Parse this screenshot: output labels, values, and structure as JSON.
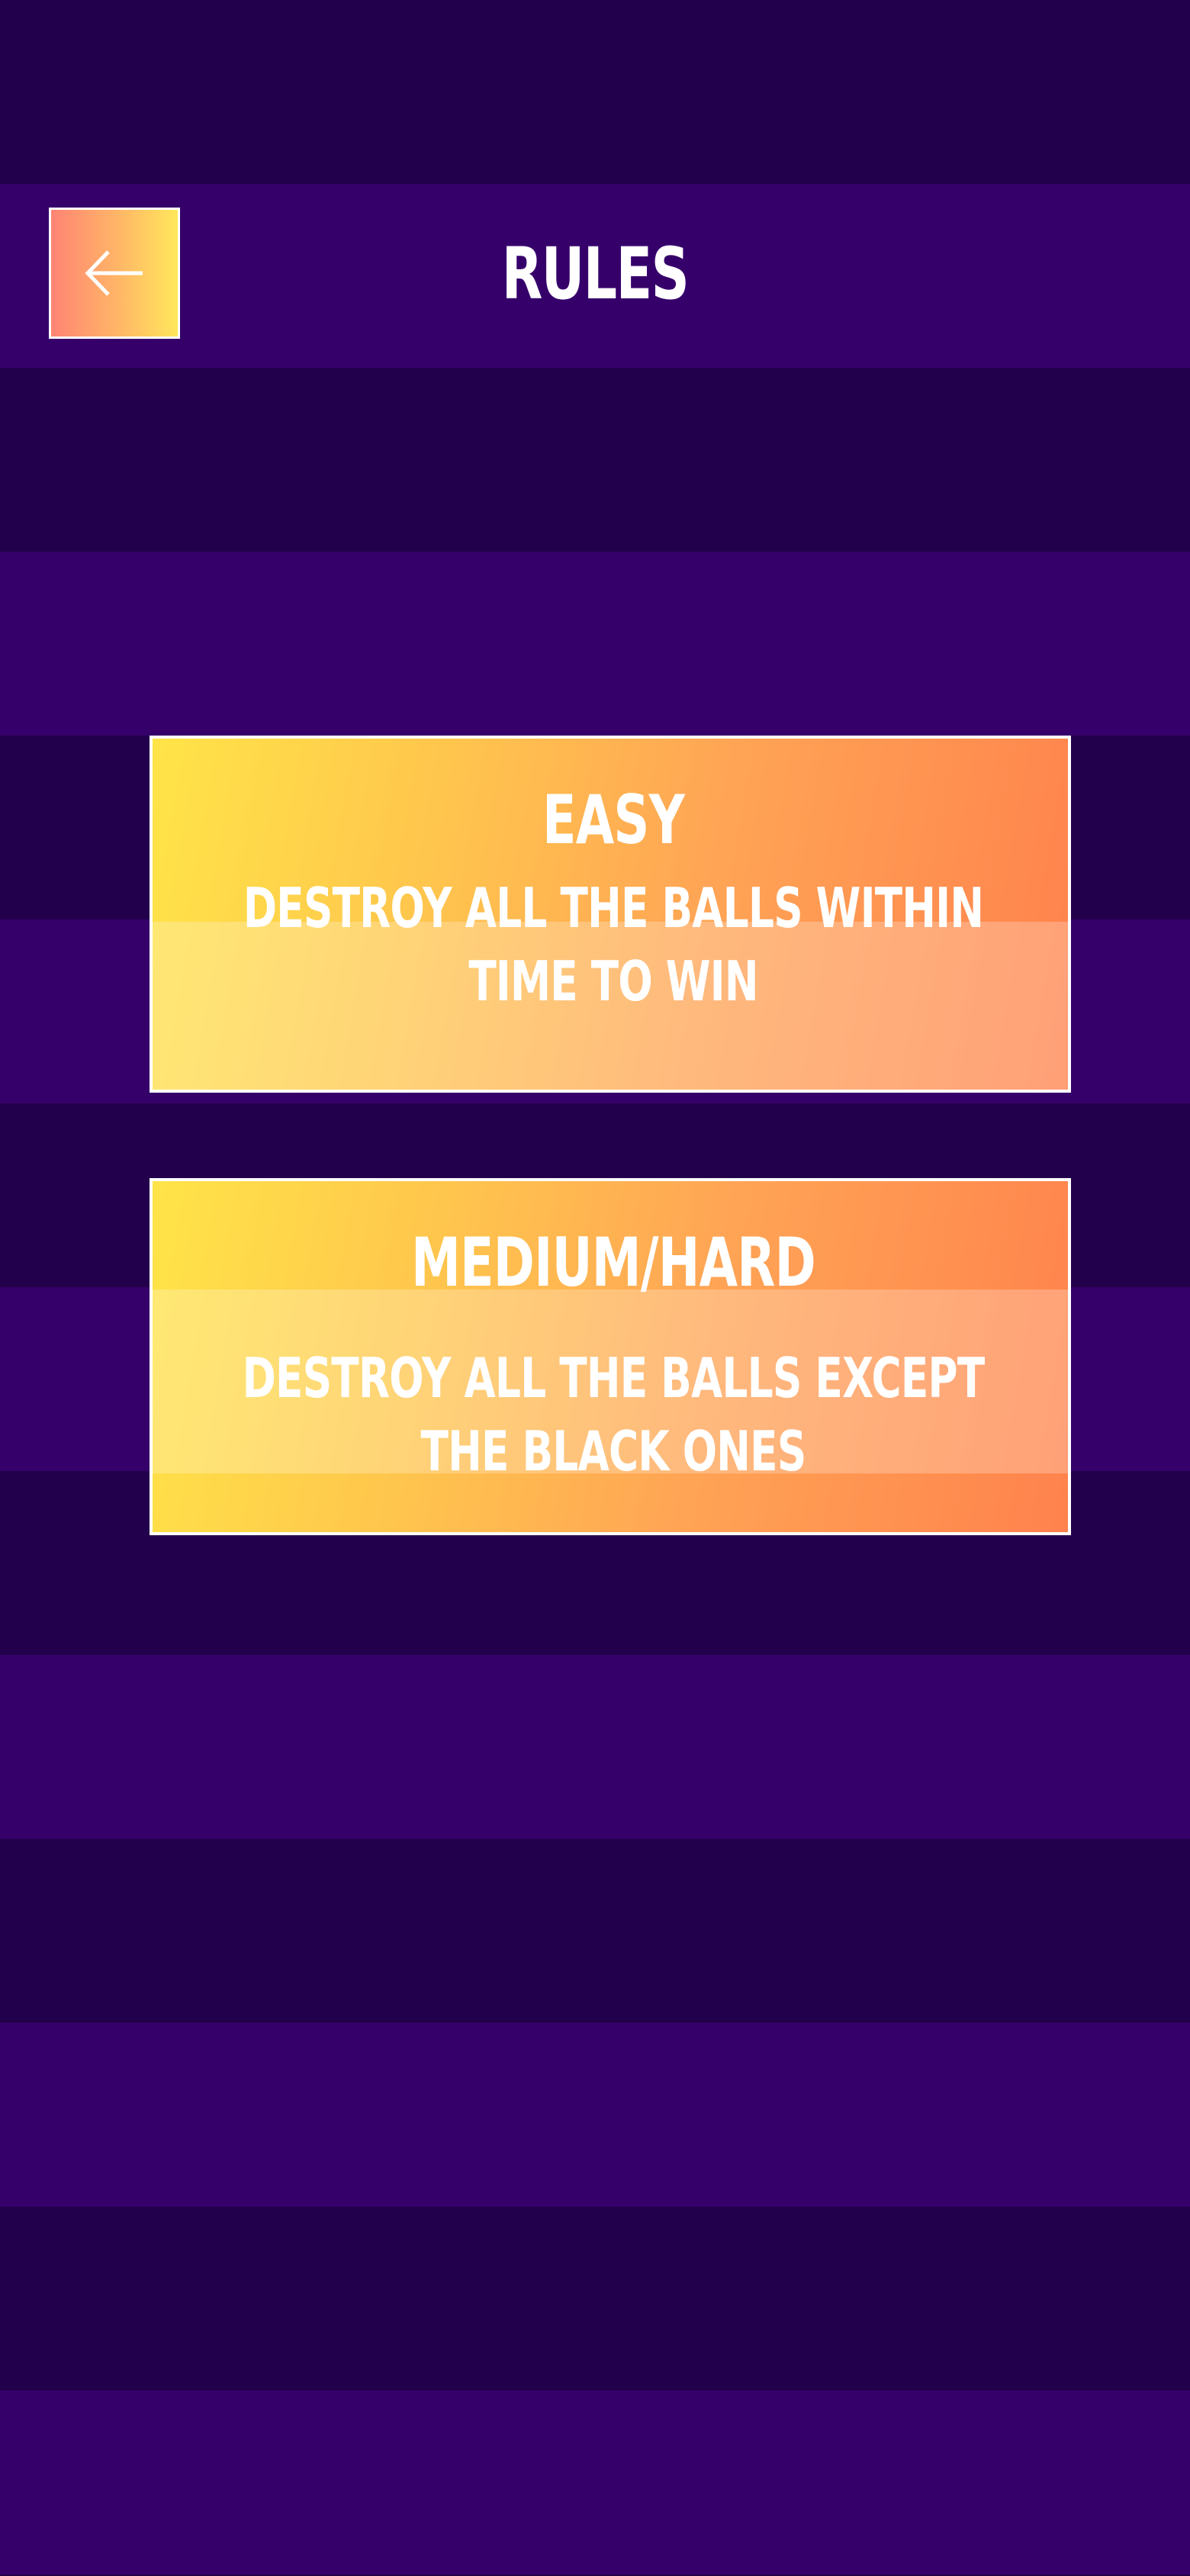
{
  "header": {
    "title": "RULES",
    "back_icon": "arrow-left-icon"
  },
  "rules": [
    {
      "title": "EASY",
      "description": "DESTROY ALL THE BALLS WITHIN TIME TO WIN"
    },
    {
      "title": "MEDIUM/HARD",
      "description": "DESTROY ALL THE BALLS EXCEPT THE BLACK ONES"
    }
  ],
  "colors": {
    "background_dark": "#23004b",
    "background_light": "#36006b",
    "accent_yellow": "#ffe448",
    "accent_orange": "#ff824d",
    "text": "#ffffff"
  }
}
